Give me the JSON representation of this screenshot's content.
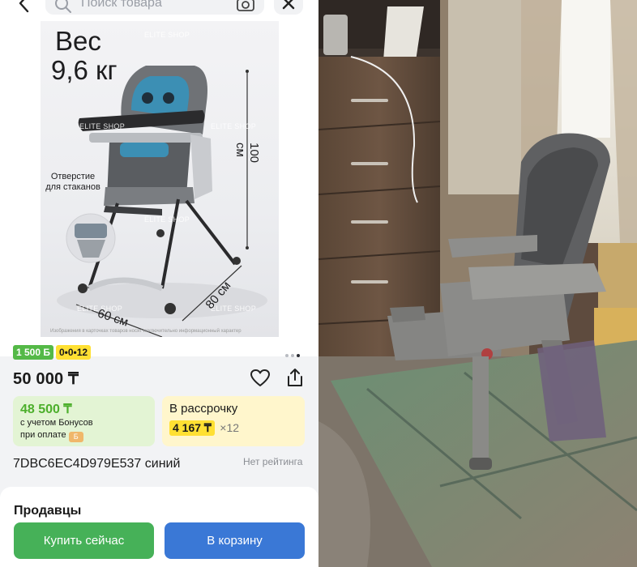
{
  "header": {
    "search_placeholder": "Поиск товара"
  },
  "gallery": {
    "weight_label": "Вес",
    "weight_value": "9,6 кг",
    "watermark": "ELITE SHOP",
    "cupholder_note": "Отверстие для стаканов",
    "dim_height": "100 см",
    "dim_depth": "80 см",
    "dim_width": "60 см",
    "disclaimer": "Изображения в карточках товаров носят исключительно информационный характер"
  },
  "badges": {
    "bonus": "1 500 Б",
    "installment": "0•0•12"
  },
  "product": {
    "price": "50 000 ₸",
    "bonus_price": "48 500 ₸",
    "bonus_note_1": "с учетом Бонусов",
    "bonus_note_2": "при оплате",
    "installment_title": "В рассрочку",
    "installment_monthly": "4 167 ₸",
    "installment_months": "×12",
    "sku_color": "7DBC6EC4D979E537 синий",
    "rating": "Нет рейтинга"
  },
  "sellers": {
    "heading": "Продавцы"
  },
  "actions": {
    "buy_now": "Купить сейчас",
    "add_to_cart": "В корзину"
  },
  "colors": {
    "buy_green": "#46b158",
    "cart_blue": "#3a78d6",
    "bonus_green": "#54b947",
    "plan_yellow": "#ffe033"
  }
}
